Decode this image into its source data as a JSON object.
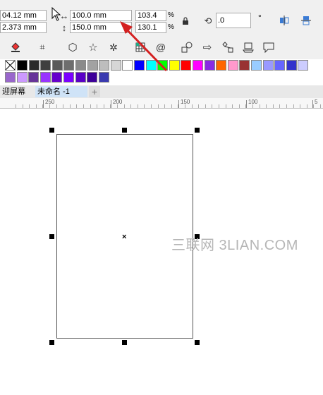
{
  "property_bar": {
    "x_value": "04.12 mm",
    "y_value": "2.373 mm",
    "width_value": "100.0 mm",
    "height_value": "150.0 mm",
    "scale_x_value": "103.4",
    "scale_y_value": "130.1",
    "percent_sign": "%",
    "rotation_value": ".0",
    "degree_sign": "°"
  },
  "palette": {
    "row1": [
      "#000000",
      "#2a2a2a",
      "#3f3f3f",
      "#5a5a5a",
      "#6e6e6e",
      "#8a8a8a",
      "#a2a2a2",
      "#bdbdbd",
      "#d6d6d6",
      "#ffffff",
      "#0000ff",
      "#00ffff",
      "#00ff00",
      "#ffff00",
      "#ff0000",
      "#ff00ff",
      "#8a2be2",
      "#ff6600",
      "#ff99cc",
      "#993333",
      "#99ccff",
      "#9999ff",
      "#6666ff",
      "#3333cc",
      "#ccccff"
    ],
    "row2": [
      "#9966cc",
      "#cc99ff",
      "#663399",
      "#9933ff",
      "#6600cc",
      "#7a00ff",
      "#5a00c8",
      "#3d0099",
      "#3a3ab0"
    ]
  },
  "tabs": {
    "welcome": "迎屏幕",
    "document": "未命名 -1",
    "add": "+"
  },
  "ruler": {
    "labels": [
      "250",
      "200",
      "150",
      "100",
      "5"
    ]
  },
  "watermark": "三联网 3LIAN.COM",
  "colors": {
    "arrow": "#d42020",
    "selection": "#000000"
  }
}
